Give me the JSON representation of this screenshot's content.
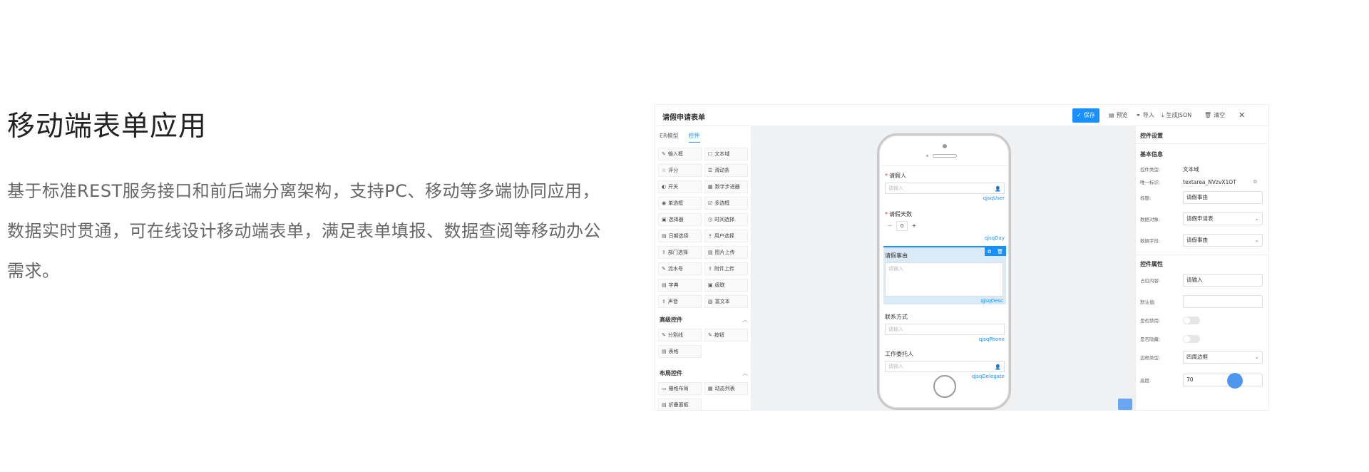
{
  "hero": {
    "title": "移动端表单应用",
    "description": "基于标准REST服务接口和前后端分离架构，支持PC、移动等多端协同应用，数据实时贯通，可在线设计移动端表单，满足表单填报、数据查阅等移动办公需求。"
  },
  "app": {
    "title": "请假申请表单",
    "toolbar": {
      "save": "保存",
      "preview": "预览",
      "import": "导入",
      "generate_json": "生成JSON",
      "clear": "清空",
      "close_icon": "close-icon"
    },
    "palette": {
      "tabs": [
        "ER模型",
        "控件"
      ],
      "active_tab": "控件",
      "basic_items": [
        {
          "icon": "✎",
          "label": "输入框"
        },
        {
          "icon": "☐",
          "label": "文本域"
        },
        {
          "icon": "☆",
          "label": "评分"
        },
        {
          "icon": "☰",
          "label": "滑动条"
        },
        {
          "icon": "◐",
          "label": "开关"
        },
        {
          "icon": "▦",
          "label": "数字步进器"
        },
        {
          "icon": "◉",
          "label": "单选框"
        },
        {
          "icon": "☑",
          "label": "多选框"
        },
        {
          "icon": "▣",
          "label": "选择器"
        },
        {
          "icon": "◷",
          "label": "时间选择"
        },
        {
          "icon": "▤",
          "label": "日期选择"
        },
        {
          "icon": "⇪",
          "label": "用户选择"
        },
        {
          "icon": "⇪",
          "label": "部门选择"
        },
        {
          "icon": "▧",
          "label": "图片上传"
        },
        {
          "icon": "✎",
          "label": "流水号"
        },
        {
          "icon": "⇪",
          "label": "附件上传"
        },
        {
          "icon": "▤",
          "label": "字典"
        },
        {
          "icon": "▣",
          "label": "级联"
        },
        {
          "icon": "⇪",
          "label": "声音"
        },
        {
          "icon": "▧",
          "label": "富文本"
        }
      ],
      "advanced_title": "高级控件",
      "advanced_items": [
        {
          "icon": "✎",
          "label": "分割线"
        },
        {
          "icon": "✎",
          "label": "按钮"
        },
        {
          "icon": "▤",
          "label": "表格"
        }
      ],
      "layout_title": "布局控件",
      "layout_items": [
        {
          "icon": "▭",
          "label": "栅格布局"
        },
        {
          "icon": "▦",
          "label": "动态列表"
        },
        {
          "icon": "▤",
          "label": "折叠面板"
        }
      ]
    },
    "form": {
      "applicant_label": "请假人",
      "applicant_placeholder": "请输入",
      "applicant_code": "qjsqUser",
      "days_label": "请假天数",
      "days_value": "0",
      "days_code": "qjsqDay",
      "reason_label": "请假事由",
      "reason_placeholder": "请输入",
      "reason_code": "qjsqDesc",
      "contact_label": "联系方式",
      "contact_placeholder": "请输入",
      "contact_code": "qjsqPhone",
      "delegate_label": "工作委托人",
      "delegate_placeholder": "请输入",
      "delegate_code": "qjsqDelegate"
    },
    "props": {
      "title": "控件设置",
      "basic_section": "基本信息",
      "type_label": "控件类型:",
      "type_value": "文本域",
      "id_label": "唯一标识:",
      "id_value": "textarea_NVzvX1OT",
      "title_label": "标题:",
      "title_value": "请假事由",
      "object_label": "数据对象:",
      "object_value": "请假申请表",
      "field_label": "数据字段:",
      "field_value": "请假事由",
      "attr_section": "控件属性",
      "placeholder_label": "占位内容:",
      "placeholder_value": "请输入",
      "default_label": "默认值:",
      "default_value": "",
      "disabled_label": "是否禁用:",
      "hidden_label": "是否隐藏:",
      "border_label": "边框类型:",
      "border_value": "四周边框",
      "height_label": "高度:",
      "height_value": "70"
    }
  }
}
